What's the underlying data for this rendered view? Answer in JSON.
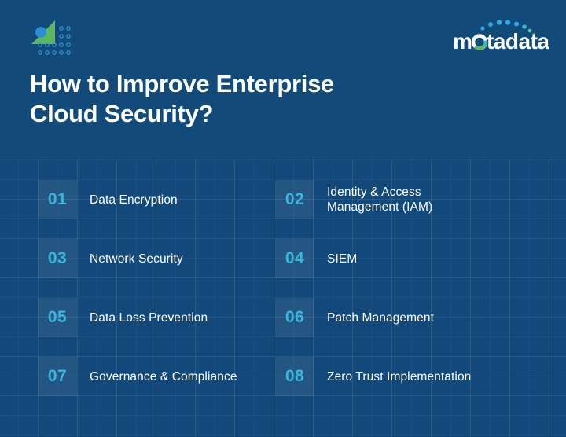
{
  "brand": {
    "mark_name": "motadata-triangle-dots-mark",
    "logo_text": "motadata",
    "logo_prefix": "m",
    "logo_suffix": "tadata"
  },
  "title": {
    "line1": "How to Improve Enterprise",
    "line2": "Cloud Security?"
  },
  "colors": {
    "background": "#124B79",
    "grid_line": "#1C5685",
    "number_accent": "#39B6DC",
    "text": "#FFFFFF",
    "mark_green": "#5CB85C",
    "mark_blue": "#2A8FD4",
    "logo_dot": "#2FA8E0",
    "logo_dot_teal": "#4BC0A8"
  },
  "items": [
    {
      "number": "01",
      "label_line1": "Data Encryption",
      "label_line2": ""
    },
    {
      "number": "02",
      "label_line1": "Identity & Access",
      "label_line2": "Management (IAM)"
    },
    {
      "number": "03",
      "label_line1": "Network Security",
      "label_line2": ""
    },
    {
      "number": "04",
      "label_line1": "SIEM",
      "label_line2": ""
    },
    {
      "number": "05",
      "label_line1": "Data Loss Prevention",
      "label_line2": ""
    },
    {
      "number": "06",
      "label_line1": "Patch Management",
      "label_line2": ""
    },
    {
      "number": "07",
      "label_line1": "Governance & Compliance",
      "label_line2": ""
    },
    {
      "number": "08",
      "label_line1": "Zero Trust Implementation",
      "label_line2": ""
    }
  ]
}
